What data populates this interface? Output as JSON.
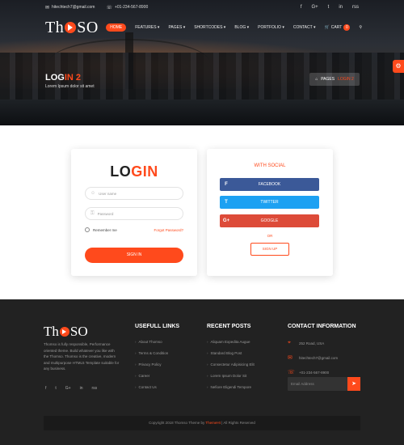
{
  "topbar": {
    "email": "hitechtech7@gmail.com",
    "phone": "+01-234-567-8900",
    "social": [
      "f",
      "G+",
      "t",
      "in",
      "rss"
    ]
  },
  "nav": {
    "logo_left": "Th",
    "logo_right": "SO",
    "items": [
      {
        "label": "HOME"
      },
      {
        "label": "FEATURES"
      },
      {
        "label": "PAGES"
      },
      {
        "label": "SHORTCODES"
      },
      {
        "label": "BLOG"
      },
      {
        "label": "PORTFOLIO"
      },
      {
        "label": "CONTACT"
      }
    ],
    "cart_label": "Cart",
    "cart_count": "0"
  },
  "header": {
    "title_prefix": "LOG",
    "title_highlight": "IN 2",
    "subtitle": "Lorem Ipsum dolor sit amet",
    "breadcrumb_home": "PAGES",
    "breadcrumb_current": "LOGIN 2"
  },
  "login": {
    "title_prefix": "LO",
    "title_highlight": "GIN",
    "username_placeholder": "User name",
    "password_placeholder": "Password",
    "remember_label": "Remember me",
    "forgot_label": "Forgot Password?",
    "signin_label": "SIGN IN"
  },
  "social_login": {
    "title": "WITH SOCIAL",
    "facebook_label": "FACEBOOK",
    "twitter_label": "TWITTER",
    "google_label": "GOOGLE",
    "or_label": "OR",
    "signup_label": "SIGN UP",
    "colors": {
      "facebook": "#3b5998",
      "twitter": "#1da1f2",
      "google": "#dd4b39"
    }
  },
  "footer": {
    "about": "Thomso is fully responsible, Performance oriented theme. Build whatever you like with the Thomso. Thomso is the creative, modern and multipurpose HTML5 Template suitable for any business.",
    "social": [
      "f",
      "t",
      "G+",
      "in",
      "rss"
    ],
    "links_title": "USEFULL LINKS",
    "links": [
      "About Thomso",
      "Terms & Condition",
      "Privacy Policy",
      "Career",
      "Contact Us"
    ],
    "posts_title": "RECENT POSTS",
    "posts": [
      "Aliquam Expedita Augue",
      "Standard Blog Post",
      "Consectetur Adipisicing Elit",
      "Lorem Ipsum Dolor Sit",
      "Nefiore Eligendi Tempore"
    ],
    "contact_title": "CONTACT INFORMATION",
    "contact": {
      "address": "252 Road, USA",
      "email": "hitechtech7@gmail.com",
      "phone": "+01-234-567-8900"
    },
    "email_placeholder": "Email Address",
    "copyright_prefix": "Copyright 2018 Thomso Theme by",
    "copyright_brand": "ThemeHt",
    "copyright_suffix": "| All Rights Reserved"
  },
  "colors": {
    "accent": "#ff4a1c",
    "footer_bg": "#222222"
  }
}
